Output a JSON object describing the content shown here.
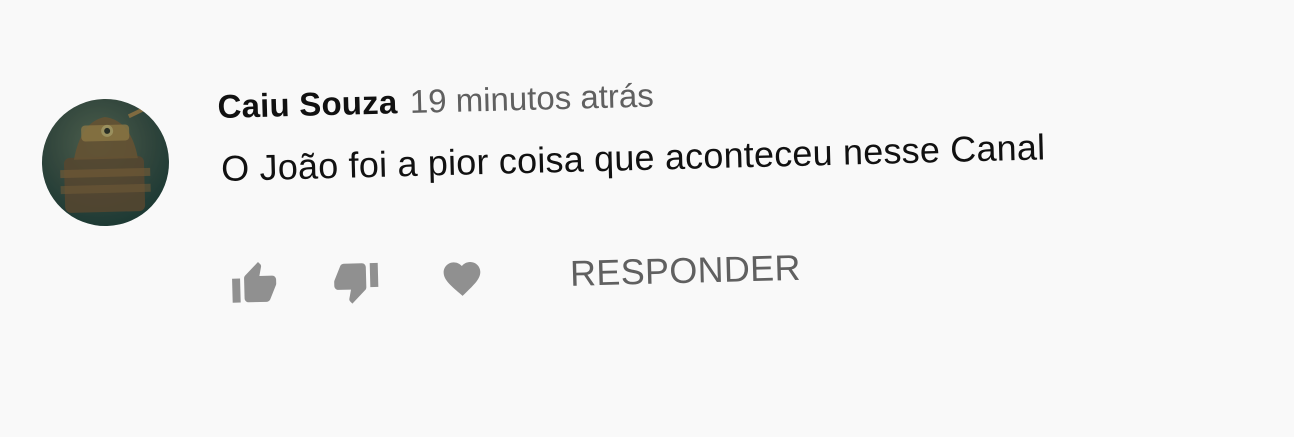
{
  "comment": {
    "author": "Caiu Souza",
    "timestamp": "19 minutos atrás",
    "text": "O João foi a pior coisa que aconteceu nesse Canal"
  },
  "actions": {
    "like_icon": "thumbs-up-icon",
    "dislike_icon": "thumbs-down-icon",
    "heart_icon": "heart-icon",
    "reply_label": "RESPONDER"
  },
  "colors": {
    "background": "#f9f9f9",
    "author": "#111111",
    "secondary": "#606060",
    "icon": "#909090"
  }
}
